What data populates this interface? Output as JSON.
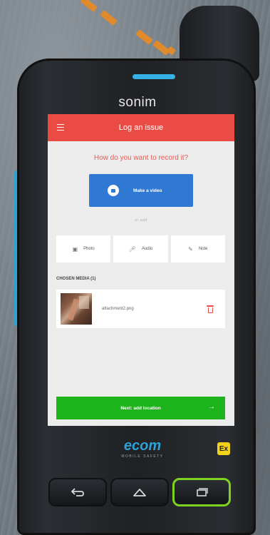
{
  "device": {
    "brand": "sonim",
    "maker_logo": "ecom",
    "maker_tagline": "MOBILE SAFETY",
    "ex_badge": "Ex",
    "accent_color": "#2aa3d6"
  },
  "app": {
    "title": "Log an issue",
    "menu_icon": "hamburger-icon",
    "header_color": "#ea4b45",
    "prompt": "How do you want to record it?",
    "primary_action": {
      "label": "Make a video",
      "icon": "video-icon",
      "color": "#2f78d3"
    },
    "or_add": "or add",
    "options": [
      {
        "label": "Photo",
        "icon": "camera-icon"
      },
      {
        "label": "Audio",
        "icon": "microphone-icon"
      },
      {
        "label": "Note",
        "icon": "pencil-icon"
      }
    ],
    "chosen_media_heading": "CHOSEN MEDIA (1)",
    "media": [
      {
        "filename": "attachment2.png",
        "delete_icon": "trash-icon"
      }
    ],
    "next_button": {
      "label": "Next: add location",
      "icon": "arrow-right-icon",
      "color": "#1db31b"
    }
  },
  "hardware_buttons": {
    "back": "back-icon",
    "home": "home-icon",
    "recent": "recent-apps-icon"
  }
}
